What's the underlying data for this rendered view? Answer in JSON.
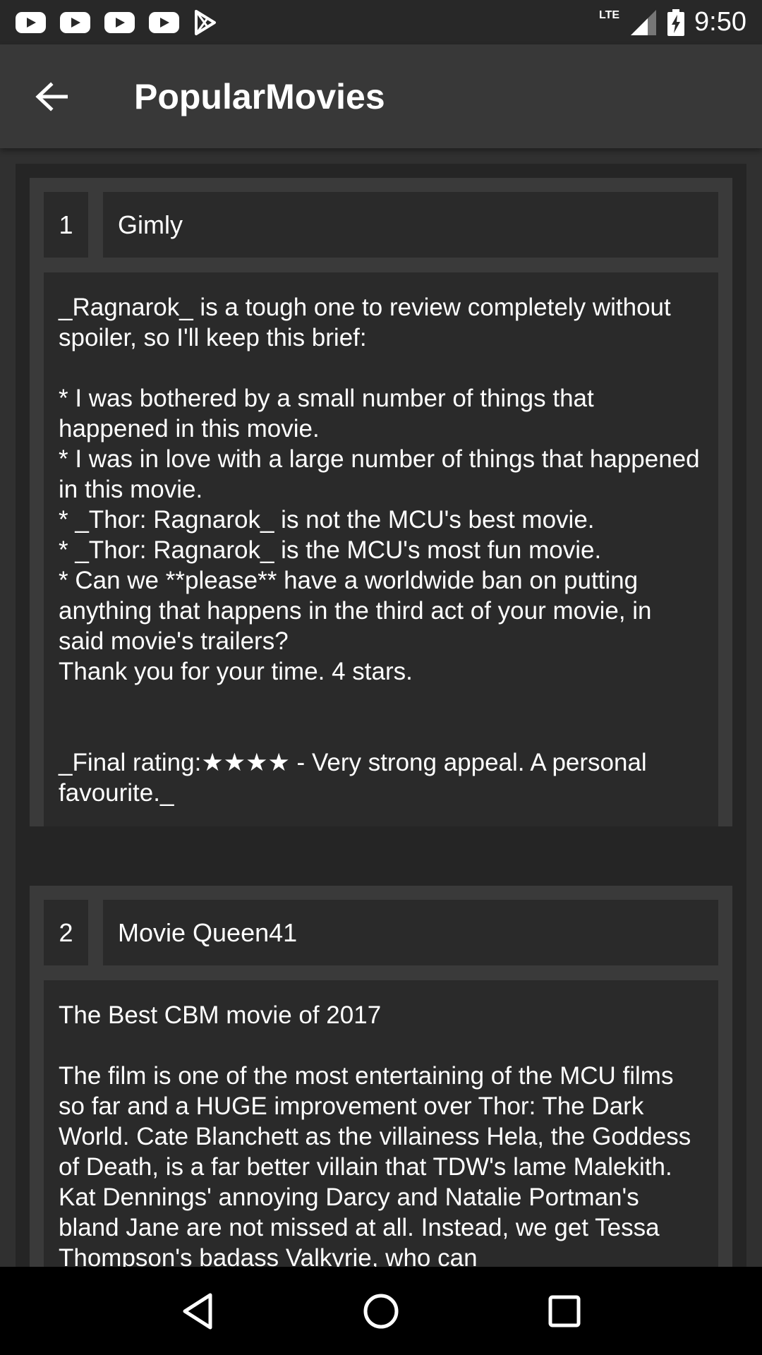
{
  "status_bar": {
    "time": "9:50",
    "network": "LTE",
    "notification_icons": [
      "youtube-icon",
      "youtube-icon",
      "youtube-icon",
      "youtube-icon",
      "play-store-icon"
    ]
  },
  "app_bar": {
    "title": "PopularMovies",
    "back_icon": "arrow-back-icon"
  },
  "reviews": [
    {
      "index": "1",
      "author": "Gimly",
      "content": "_Ragnarok_ is a tough one to review completely without spoiler, so I'll keep this brief:\n\n* I was bothered by a small number of things that happened in this movie.\n* I was in love with a large number of things that happened in this movie.\n* _Thor: Ragnarok_ is not the MCU's best movie.\n* _Thor: Ragnarok_ is the MCU's most fun movie.\n* Can we **please** have a worldwide ban on putting anything that happens in the third act of your movie, in said movie's trailers?\nThank you for your time. 4 stars.\n\n\n_Final rating:★★★★ - Very strong appeal. A personal favourite._"
    },
    {
      "index": "2",
      "author": "Movie Queen41",
      "content": "The Best CBM movie of 2017\n\nThe film is one of the most entertaining of the MCU films so far and a HUGE improvement over Thor: The Dark World. Cate Blanchett as the villainess Hela, the Goddess of Death, is a far better villain that TDW's lame Malekith. Kat Dennings' annoying Darcy and Natalie Portman's bland Jane are not missed at all. Instead, we get Tessa Thompson's badass Valkyrie, who can"
    }
  ],
  "nav_bar": {
    "icons": [
      "back-triangle-icon",
      "home-circle-icon",
      "recents-square-icon"
    ]
  },
  "colors": {
    "status_bar": "#282828",
    "app_bar": "#383838",
    "background": "#303030",
    "card": "#3a3a3a",
    "field": "#2a2a2a",
    "nav_bar": "#000000",
    "text": "#ffffff"
  }
}
